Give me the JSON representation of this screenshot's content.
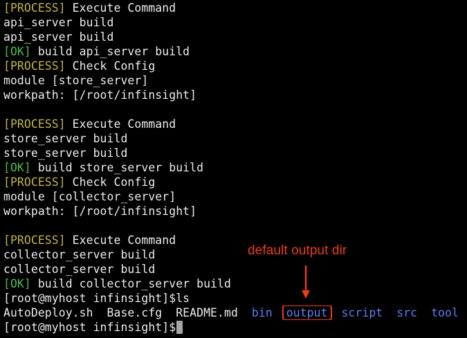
{
  "tags": {
    "process": "[PROCESS]",
    "ok": "[OK]"
  },
  "blocks": [
    {
      "execute": " Execute Command",
      "output_lines": [
        "api_server build",
        "api_server build"
      ],
      "ok_text": " build api_server build",
      "check": " Check Config",
      "module": "module [store_server]",
      "workpath": "workpath: [/root/infinsight]"
    },
    {
      "execute": " Execute Command",
      "output_lines": [
        "store_server build",
        "store_server build"
      ],
      "ok_text": " build store_server build",
      "check": " Check Config",
      "module": "module [collector_server]",
      "workpath": "workpath: [/root/infinsight]"
    },
    {
      "execute": " Execute Command",
      "output_lines": [
        "collector_server build",
        "collector_server build"
      ],
      "ok_text": " build collector_server build"
    }
  ],
  "prompt": "[root@myhost infinsight]$",
  "command": "ls",
  "ls_files": [
    "AutoDeploy.sh",
    "Base.cfg",
    "README.md"
  ],
  "ls_dirs": [
    "bin",
    "output",
    "script",
    "src",
    "tool"
  ],
  "annotation": {
    "text": "default output dir",
    "color": "#ef3c19"
  },
  "colors": {
    "background": "#000000",
    "text": "#ededed",
    "process_tag": "#c2b745",
    "ok_tag": "#4cc14c",
    "directory": "#5b7ff7",
    "cursor": "#a5a5a5"
  }
}
